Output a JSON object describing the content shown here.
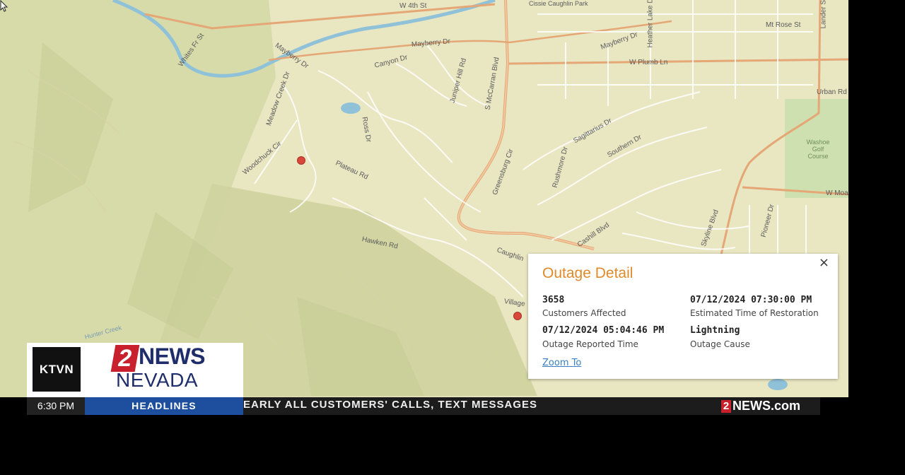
{
  "map": {
    "road_labels": [
      "W 4th St",
      "Whites Fr St",
      "Mayberry Dr",
      "Canyon Dr",
      "Mayberry Dr",
      "Mayberry Dr",
      "Mt Rose St",
      "W Plumb Ln",
      "Urban Rd",
      "Juniper Hill Rd",
      "Ross Dr",
      "S McCarran Blvd",
      "Plateau Rd",
      "Greensburg Cir",
      "Sagittarius Dr",
      "Southern Dr",
      "Hawken Rd",
      "Caughlin",
      "Village",
      "Cashill Blvd",
      "Skyline Blvd",
      "Washoe Golf Course",
      "W Moana",
      "Pioneer Dr",
      "Lander St",
      "Heather Lake Dr",
      "Cissie Caughlin Park",
      "Hunter Creek",
      "Woodchuck Cir",
      "Meadow Creek Dr",
      "Rushmore Dr"
    ],
    "pin_count_visible": 2
  },
  "popup": {
    "title": "Outage Detail",
    "close_label": "×",
    "customers_value": "3658",
    "customers_label": "Customers Affected",
    "restoration_value": "07/12/2024 07:30:00 PM",
    "restoration_label": "Estimated Time of Restoration",
    "reported_value": "07/12/2024 05:04:46 PM",
    "reported_label": "Outage Reported Time",
    "cause_value": "Lightning",
    "cause_label": "Outage Cause",
    "zoom_label": "Zoom To"
  },
  "broadcast": {
    "station": "KTVN",
    "logo_number": "2",
    "logo_news": "NEWS",
    "logo_region": "NEVADA",
    "time": "6:30 PM",
    "segment": "HEADLINES",
    "crawl_text": "EARLY ALL CUSTOMERS' CALLS, TEXT MESSAGES",
    "brand_number": "2",
    "brand_text": "NEWS.com"
  },
  "colors": {
    "popup_title": "#e08a2a",
    "pin": "#d9463a",
    "headlines_bg": "#1d4f9e",
    "logo_red": "#c8202c",
    "logo_navy": "#1f2d6a"
  }
}
